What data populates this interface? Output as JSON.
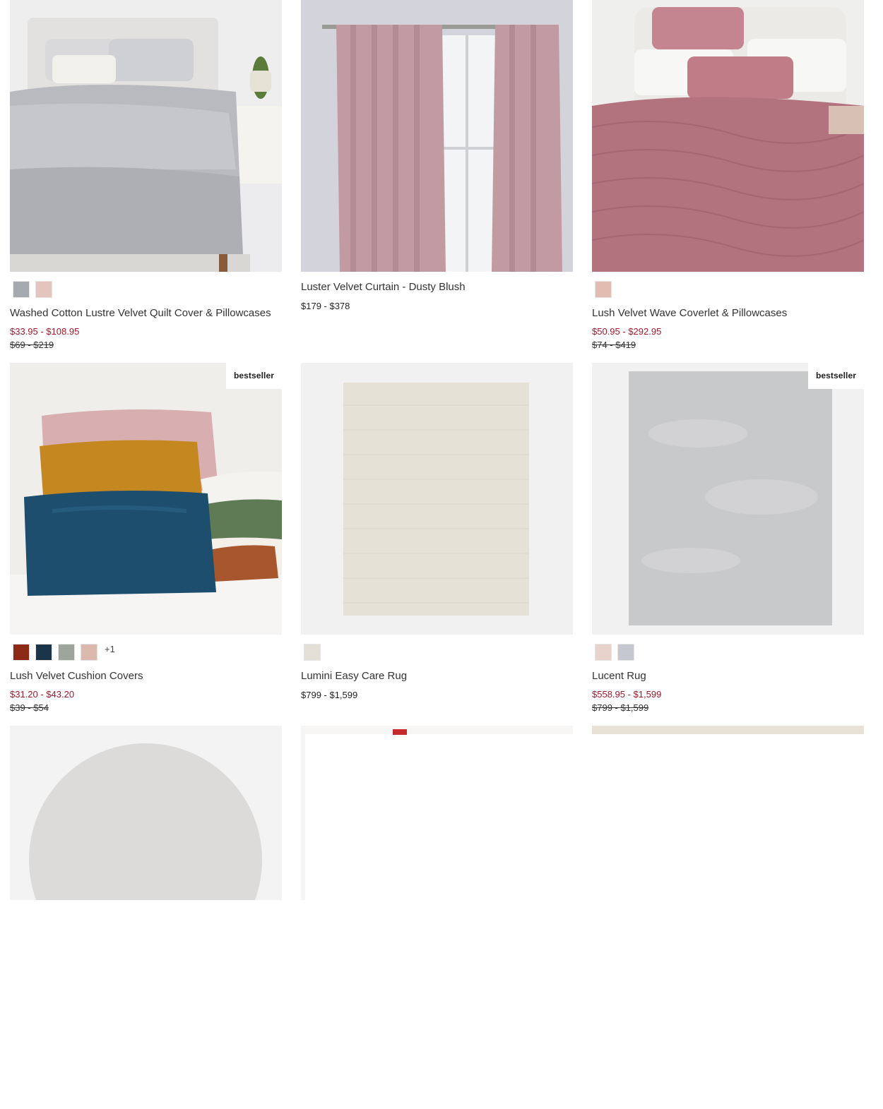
{
  "products": [
    {
      "title": "Washed Cotton Lustre Velvet Quilt Cover & Pillowcases",
      "price_sale": "$33.95 - $108.95",
      "price_orig": "$69 - $219",
      "swatches": [
        "#a7a9b0",
        "#e3c4bf"
      ],
      "swatch_more": ""
    },
    {
      "title": "Luster Velvet Curtain - Dusty Blush",
      "price_regular": "$179 - $378"
    },
    {
      "title": "Lush Velvet Wave Coverlet & Pillowcases",
      "price_sale": "$50.95 - $292.95",
      "price_orig": "$74 - $419",
      "swatches": [
        "#e2bcb1"
      ]
    },
    {
      "title": "Lush Velvet Cushion Covers",
      "badge": "bestseller",
      "price_sale": "$31.20 - $43.20",
      "price_orig": "$39 - $54",
      "swatches": [
        "#8b2a15",
        "#1b3448",
        "#9fa49d",
        "#dcb9ad"
      ],
      "swatch_more": "+1"
    },
    {
      "title": "Lumini Easy Care Rug",
      "price_regular": "$799 - $1,599",
      "swatches": [
        "#e4e0d8"
      ]
    },
    {
      "title": "Lucent Rug",
      "badge": "bestseller",
      "price_sale": "$558.95 - $1,599",
      "price_orig": "$799 - $1,599",
      "swatches": [
        "#e7d3cc",
        "#c5c8d0"
      ]
    }
  ]
}
